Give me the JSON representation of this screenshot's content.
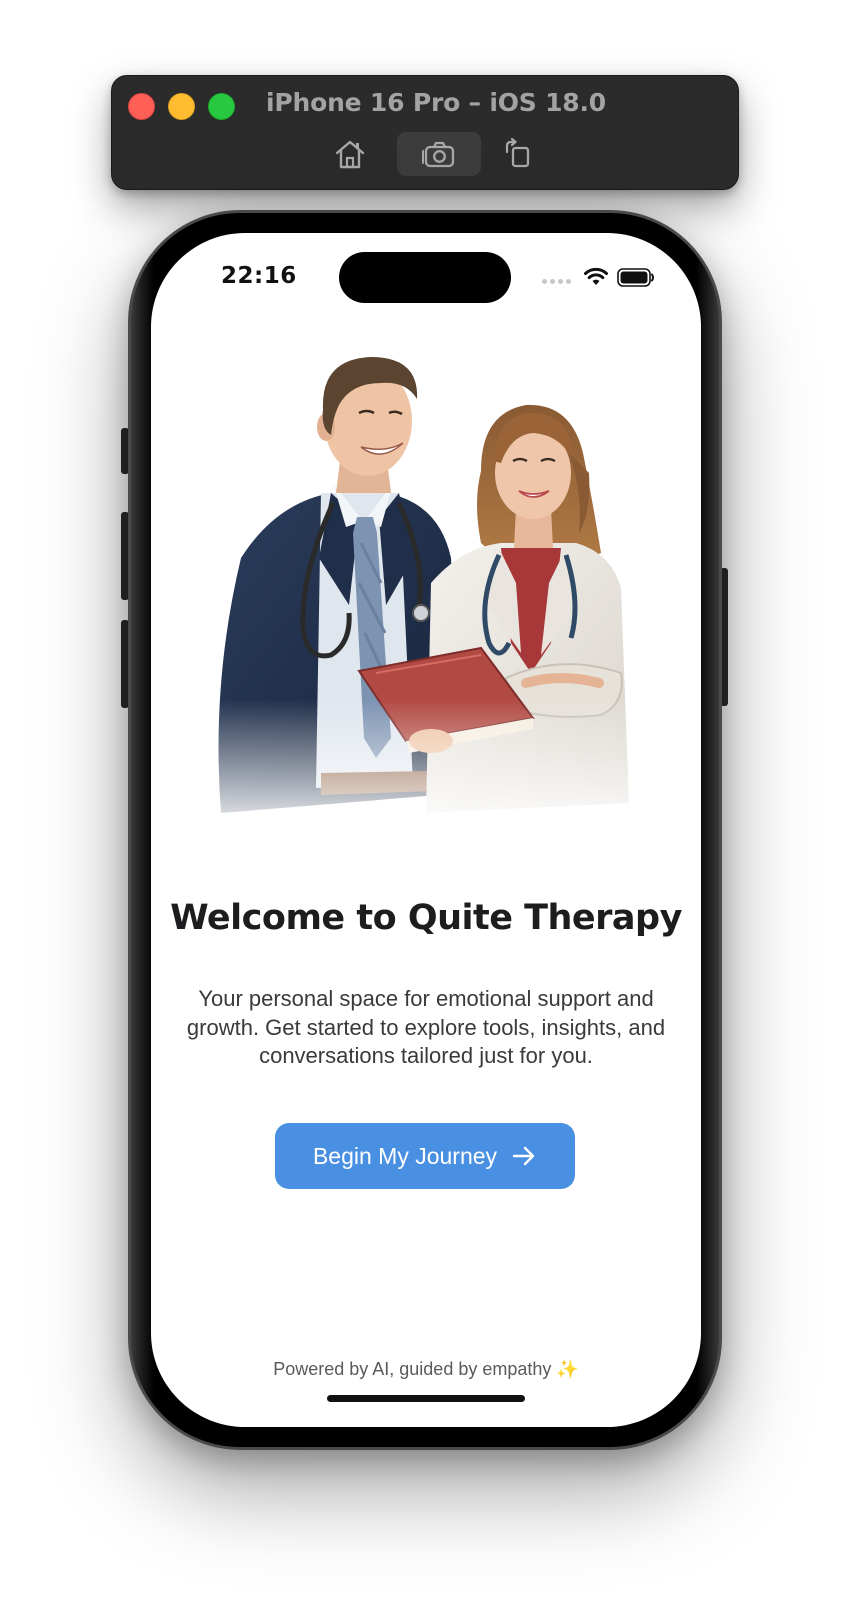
{
  "simulator": {
    "title": "iPhone 16 Pro – iOS 18.0",
    "toolbar": {
      "home_icon": "home-icon",
      "screenshot_icon": "camera-icon",
      "rotate_icon": "rotate-icon"
    },
    "traffic_lights": {
      "close_color": "#fe5f57",
      "minimize_color": "#febc2e",
      "zoom_color": "#28c840"
    }
  },
  "status_bar": {
    "time": "22:16",
    "icons": [
      "cellular-icon",
      "wifi-icon",
      "battery-icon"
    ]
  },
  "welcome": {
    "illustration": "doctors-illustration",
    "title": "Welcome to Quite Therapy",
    "subtitle": "Your personal space for emotional support and growth. Get started to explore tools, insights, and conversations tailored just for you.",
    "cta_label": "Begin My Journey",
    "cta_icon": "arrow-right-icon",
    "footer": "Powered by AI, guided by empathy ✨"
  },
  "colors": {
    "accent": "#4a90e2",
    "title_text": "#1d1d1f",
    "body_text": "#3a3a3c"
  }
}
